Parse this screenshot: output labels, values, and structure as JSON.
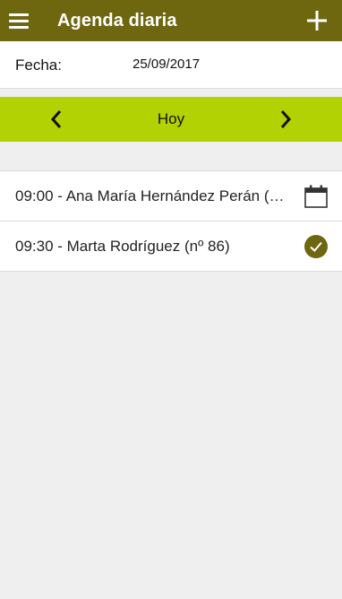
{
  "header": {
    "title": "Agenda diaria",
    "menu_icon": "hamburger-menu-icon",
    "add_icon": "plus-icon"
  },
  "date": {
    "label": "Fecha:",
    "value": "25/09/2017"
  },
  "nav": {
    "today_label": "Hoy",
    "prev_icon": "chevron-left-icon",
    "next_icon": "chevron-right-icon"
  },
  "appointments": [
    {
      "text": "09:00 - Ana María Hernández Perán (nº...",
      "status_icon": "calendar-icon"
    },
    {
      "text": "09:30 - Marta Rodríguez (nº 86)",
      "status_icon": "check-circle-icon"
    }
  ],
  "colors": {
    "appbar": "#6f6610",
    "nav_bar": "#b3d204",
    "check_badge": "#6f6610",
    "background": "#efefef"
  }
}
